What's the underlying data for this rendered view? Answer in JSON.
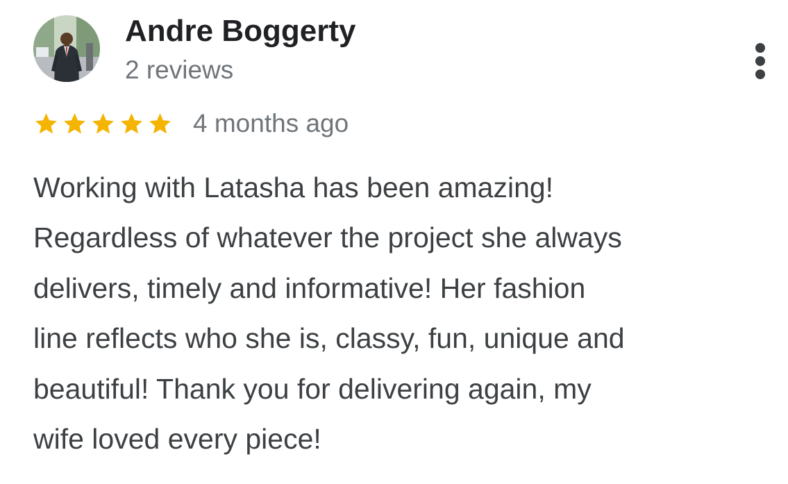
{
  "review": {
    "author": {
      "name": "Andre Boggerty",
      "reviews_count": "2 reviews",
      "avatar_icon": "profile-photo"
    },
    "rating": {
      "stars": 5,
      "max_stars": 5,
      "star_color": "#F4B400"
    },
    "timestamp": "4 months ago",
    "text_lines": [
      "Working with Latasha has been amazing!",
      "Regardless of whatever the project she always",
      "delivers, timely and informative! Her fashion",
      "line reflects who she is, classy, fun, unique and",
      "beautiful! Thank you for delivering again, my",
      "wife loved every piece!"
    ],
    "menu_icon": "more-vertical-icon"
  }
}
